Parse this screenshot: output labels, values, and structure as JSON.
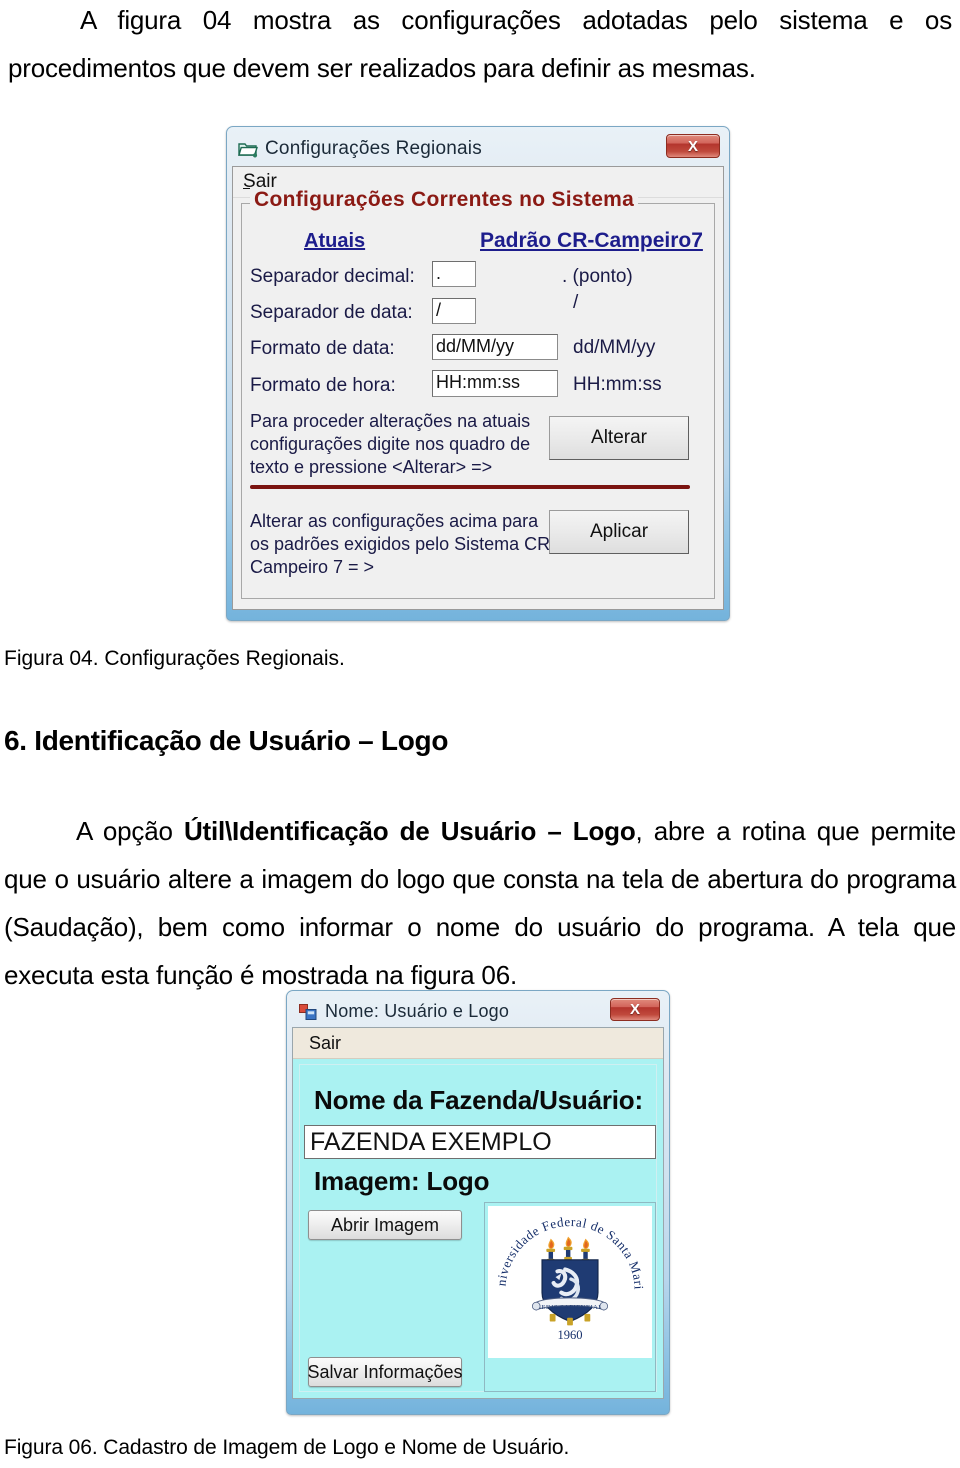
{
  "document": {
    "paragraph_1": "A figura 04 mostra as configurações adotadas pelo sistema e os procedimentos que devem ser realizados para definir as mesmas.",
    "figure_04_caption": "Figura 04. Configurações Regionais.",
    "section_heading": "6. Identificação de Usuário – Logo",
    "paragraph_2_pre": "A opção ",
    "paragraph_2_bold": "Útil\\Identificação de Usuário – Logo",
    "paragraph_2_post": ", abre a rotina que permite que o usuário altere a imagem do logo que consta na tela de abertura do programa (Saudação), bem como informar o nome do usuário do programa. A tela que executa esta função é mostrada na figura 06.",
    "figure_06_caption": "Figura 06. Cadastro de Imagem de Logo e Nome de Usuário."
  },
  "dialog_regional": {
    "title": "Configurações Regionais",
    "window_icon": "folder-settings-icon",
    "close_label": "X",
    "menu": [
      {
        "label": "Sair",
        "accelerator": "S"
      }
    ],
    "groupbox_legend": "Configurações  Correntes no Sistema",
    "column_headers": {
      "current": "Atuais",
      "standard": "Padrão CR-Campeiro7"
    },
    "fields": [
      {
        "label": "Separador decimal:",
        "value": ".",
        "standard": ". (ponto)"
      },
      {
        "label": "Separador de data:",
        "value": "/",
        "standard": "/"
      },
      {
        "label": "Formato de data:",
        "value": "dd/MM/yy",
        "standard": "dd/MM/yy"
      },
      {
        "label": "Formato de hora:",
        "value": "HH:mm:ss",
        "standard": "HH:mm:ss"
      }
    ],
    "hint_alterar": "Para proceder alterações na atuais\nconfigurações digite nos quadro de\ntexto e pressione <Alterar> =>",
    "button_alterar": "Alterar",
    "hint_aplicar": "Alterar as configurações acima para\nos padrões exigidos pelo Sistema CR\nCampeiro 7 = >",
    "button_aplicar": "Aplicar",
    "accent_rule_color": "#7b1410",
    "legend_color": "#8b1a14",
    "header_color": "#1d1d8c"
  },
  "dialog_logo": {
    "title": "Nome: Usuário e Logo",
    "window_icon": "vb-form-icon",
    "close_label": "X",
    "menu": [
      {
        "label": "Sair"
      }
    ],
    "name_heading": "Nome da Fazenda/Usuário:",
    "name_value": "FAZENDA EXEMPLO",
    "image_heading": "Imagem:  Logo",
    "button_open_image": "Abrir Imagem",
    "button_save_info": "Salvar Informações",
    "background_color": "#aaf2f2",
    "logo": {
      "circular_text": "Universidade Federal de Santa Maria",
      "banner_text": "SEDIS SAPIENTIAE",
      "year": "1960",
      "shield_color": "#1f3b73"
    }
  }
}
